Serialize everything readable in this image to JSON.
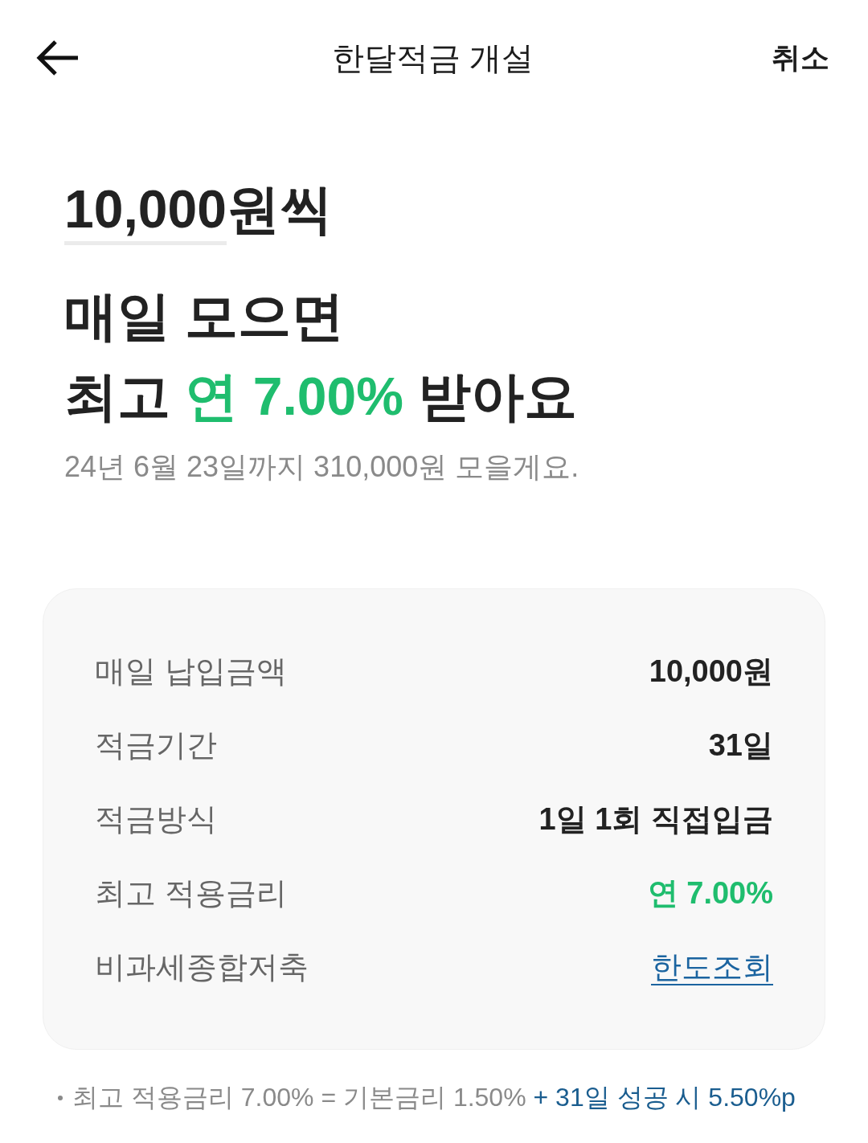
{
  "header": {
    "title": "한달적금 개설",
    "cancel": "취소"
  },
  "amount": {
    "value": "10,000",
    "suffix": "원씩"
  },
  "headline": {
    "line_1": "매일 모으면",
    "line_2": {
      "prefix": "최고",
      "highlight": "연 7.00%",
      "suffix": "받아요"
    }
  },
  "summary": "24년 6월 23일까지 310,000원 모을게요.",
  "details": [
    {
      "label": "매일 납입금액",
      "value": "10,000원",
      "kind": "plain"
    },
    {
      "label": "적금기간",
      "value": "31일",
      "kind": "plain"
    },
    {
      "label": "적금방식",
      "value": "1일 1회 직접입금",
      "kind": "plain"
    },
    {
      "label": "최고 적용금리",
      "value": "연 7.00%",
      "kind": "highlight"
    },
    {
      "label": "비과세종합저축",
      "value": "한도조회",
      "kind": "link"
    }
  ],
  "footnote": {
    "text": "최고 적용금리 7.00% = 기본금리 1.50%",
    "bonus": "+ 31일 성공 시 5.50%p"
  }
}
